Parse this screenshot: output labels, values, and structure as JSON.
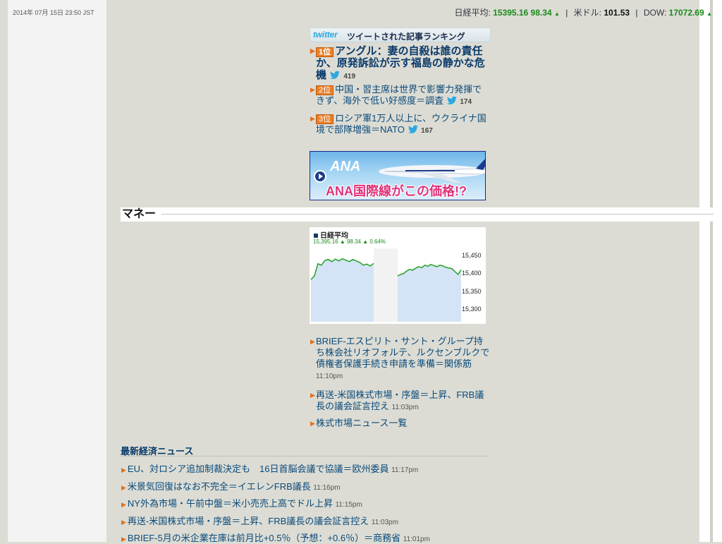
{
  "header": {
    "datetime": "2014年 07月 15日 23:50 JST",
    "ticker": {
      "nikkei_label": "日経平均:",
      "nikkei_value": "15395.16 98.34",
      "usdjpy_label": "米ドル:",
      "usdjpy_value": "101.53",
      "dow_label": "DOW:",
      "dow_value": "17072.69"
    }
  },
  "twitter_ranking": {
    "logo": "twitter",
    "title": "ツイートされた記事ランキング",
    "items": [
      {
        "rank": "1位",
        "headline": "アングル：妻の自殺は誰の責任か、原発訴訟が示す福島の静かな危機",
        "count": "419"
      },
      {
        "rank": "2位",
        "headline": "中国・習主席は世界で影響力発揮できず、海外で低い好感度＝調査",
        "count": "174"
      },
      {
        "rank": "3位",
        "headline": "ロシア軍1万人以上に、ウクライナ国境で部隊増強＝NATO",
        "count": "167"
      }
    ]
  },
  "ad_banner": {
    "logo": "ANA",
    "copy": "ANA国際線がこの価格!?"
  },
  "money": {
    "section_title": "マネー",
    "chart_title": "日経平均",
    "chart_stats": "15,395.16 ▲ 98.34 ▲ 0.64%",
    "news": [
      {
        "headline": "BRIEF-エスピリト・サント・グループ持ち株会社リオフォルテ、ルクセンブルクで債権者保護手続き申請を準備＝関係筋",
        "time": "11:10pm"
      },
      {
        "headline": "再送-米国株式市場・序盤＝上昇、FRB議長の議会証言控え",
        "time": "11:03pm"
      },
      {
        "headline": "株式市場ニュース一覧",
        "time": ""
      }
    ]
  },
  "chart_data": {
    "type": "line",
    "title": "日経平均",
    "y_ticks": [
      "15,450",
      "15,400",
      "15,350",
      "15,300"
    ],
    "ylim": [
      15270,
      15475
    ],
    "sessions": [
      {
        "name": "morning",
        "values": [
          15388,
          15398,
          15432,
          15428,
          15441,
          15444,
          15438,
          15445,
          15440,
          15446,
          15442,
          15438,
          15444,
          15440,
          15436,
          15428,
          15431,
          15426,
          15433
        ]
      },
      {
        "name": "afternoon",
        "values": [
          15398,
          15402,
          15405,
          15412,
          15416,
          15414,
          15420,
          15424,
          15421,
          15428,
          15425,
          15430,
          15427,
          15424,
          15428,
          15426,
          15422,
          15420,
          15418,
          15410,
          15402,
          15415
        ]
      }
    ],
    "colors": {
      "line": "#22a022",
      "fill": "#d4e4f6"
    }
  },
  "latest_news": {
    "title": "最新経済ニュース",
    "items": [
      {
        "headline": "EU、対ロシア追加制裁決定も　16日首脳会議で協議＝欧州委員",
        "time": "11:17pm"
      },
      {
        "headline": "米景気回復はなお不完全＝イエレンFRB議長",
        "time": "11:16pm"
      },
      {
        "headline": "NY外為市場・午前中盤＝米小売売上高でドル上昇",
        "time": "11:15pm"
      },
      {
        "headline": "再送-米国株式市場・序盤＝上昇、FRB議長の議会証言控え",
        "time": "11:03pm"
      },
      {
        "headline": "BRIEF-5月の米企業在庫は前月比+0.5％（予想：+0.6％）＝商務省",
        "time": "11:01pm"
      }
    ]
  }
}
